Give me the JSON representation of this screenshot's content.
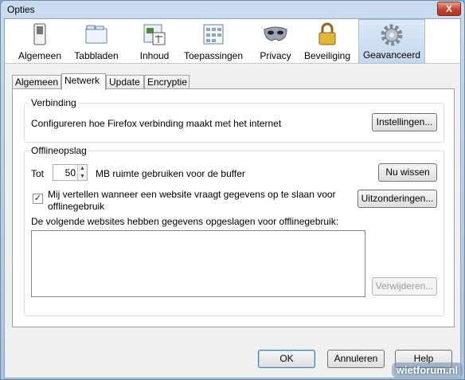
{
  "window": {
    "title": "Opties",
    "close_glyph": "X"
  },
  "toolbar": {
    "panes": [
      {
        "label": "Algemeen",
        "icon": "switch-icon"
      },
      {
        "label": "Tabbladen",
        "icon": "tabs-icon"
      },
      {
        "label": "Inhoud",
        "icon": "content-icon"
      },
      {
        "label": "Toepassingen",
        "icon": "applications-icon"
      },
      {
        "label": "Privacy",
        "icon": "mask-icon"
      },
      {
        "label": "Beveiliging",
        "icon": "lock-icon"
      },
      {
        "label": "Geavanceerd",
        "icon": "gear-icon",
        "selected": true
      }
    ]
  },
  "subtabs": [
    "Algemeen",
    "Netwerk",
    "Update",
    "Encryptie"
  ],
  "active_subtab": "Netwerk",
  "connection": {
    "legend": "Verbinding",
    "description": "Configureren hoe Firefox verbinding maakt met het internet",
    "settings_button": "Instellingen..."
  },
  "offline": {
    "legend": "Offlineopslag",
    "prefix": "Tot",
    "cache_value": "50",
    "cache_suffix": "MB ruimte gebruiken voor de buffer",
    "clear_button": "Nu wissen",
    "notify_label_line1": "Mij vertellen wanneer een website vraagt gegevens op te slaan voor",
    "notify_label_line2": "offlinegebruik",
    "notify_checked": true,
    "exceptions_button": "Uitzonderingen...",
    "list_label": "De volgende websites hebben gegevens opgeslagen voor offlinegebruik:",
    "remove_button": "Verwijderen..."
  },
  "footer": {
    "ok": "OK",
    "cancel": "Annuleren",
    "help": "Help"
  },
  "watermark": "wietforum.nl"
}
